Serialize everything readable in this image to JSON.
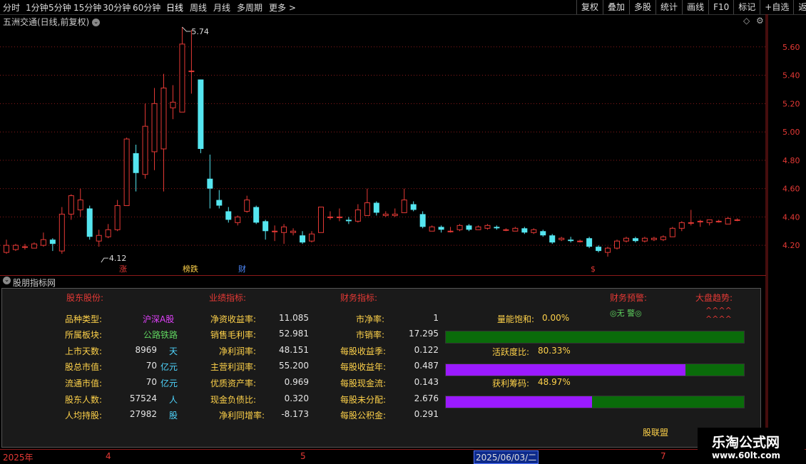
{
  "toolbar": {
    "periods": [
      "分时",
      "1分钟",
      "5分钟",
      "15分钟",
      "30分钟",
      "60分钟",
      "日线",
      "周线",
      "月线",
      "多周期",
      "更多 >"
    ],
    "active_period": "日线",
    "right_buttons": [
      "复权",
      "叠加",
      "多股",
      "统计",
      "画线",
      "F10",
      "标记",
      "+自选",
      "返回"
    ]
  },
  "chart": {
    "title": "五洲交通(日线,前复权)",
    "max_label": "5.74",
    "min_label": "4.12",
    "markers": [
      {
        "text": "涨",
        "color": "#e53935"
      },
      {
        "text": "榜跌",
        "color": "#ffd24a"
      },
      {
        "text": "财",
        "color": "#4f8bff"
      },
      {
        "text": "$",
        "color": "#e53935"
      }
    ]
  },
  "chart_data": {
    "type": "candlestick",
    "yticks": [
      4.2,
      4.4,
      4.6,
      4.8,
      5.0,
      5.2,
      5.4,
      5.6
    ],
    "ylim": [
      4.06,
      5.78
    ],
    "x_labels": [
      "2025年",
      "4",
      "5",
      "2025/06/03/二",
      "7"
    ],
    "candles": [
      {
        "o": 4.15,
        "c": 4.2,
        "h": 4.24,
        "l": 4.14
      },
      {
        "o": 4.17,
        "c": 4.2,
        "h": 4.21,
        "l": 4.16
      },
      {
        "o": 4.19,
        "c": 4.19,
        "h": 4.21,
        "l": 4.17
      },
      {
        "o": 4.18,
        "c": 4.21,
        "h": 4.22,
        "l": 4.18
      },
      {
        "o": 4.2,
        "c": 4.24,
        "h": 4.29,
        "l": 4.19
      },
      {
        "o": 4.24,
        "c": 4.21,
        "h": 4.25,
        "l": 4.16
      },
      {
        "o": 4.16,
        "c": 4.42,
        "h": 4.47,
        "l": 4.14
      },
      {
        "o": 4.42,
        "c": 4.55,
        "h": 4.56,
        "l": 4.38
      },
      {
        "o": 4.45,
        "c": 4.52,
        "h": 4.6,
        "l": 4.4
      },
      {
        "o": 4.46,
        "c": 4.26,
        "h": 4.48,
        "l": 4.24
      },
      {
        "o": 4.23,
        "c": 4.27,
        "h": 4.31,
        "l": 4.19
      },
      {
        "o": 4.26,
        "c": 4.31,
        "h": 4.35,
        "l": 4.25
      },
      {
        "o": 4.31,
        "c": 4.48,
        "h": 4.52,
        "l": 4.3
      },
      {
        "o": 4.48,
        "c": 4.95,
        "h": 4.96,
        "l": 4.48
      },
      {
        "o": 4.85,
        "c": 4.71,
        "h": 4.91,
        "l": 4.58
      },
      {
        "o": 4.7,
        "c": 5.04,
        "h": 5.2,
        "l": 4.67
      },
      {
        "o": 4.86,
        "c": 5.2,
        "h": 5.31,
        "l": 4.73
      },
      {
        "o": 4.88,
        "c": 5.31,
        "h": 5.41,
        "l": 4.58
      },
      {
        "o": 5.17,
        "c": 5.21,
        "h": 5.33,
        "l": 5.09
      },
      {
        "o": 5.14,
        "c": 5.62,
        "h": 5.74,
        "l": 5.14
      },
      {
        "o": 5.43,
        "c": 5.43,
        "h": 5.72,
        "l": 5.27
      },
      {
        "o": 5.37,
        "c": 4.88,
        "h": 5.37,
        "l": 4.85
      },
      {
        "o": 4.67,
        "c": 4.6,
        "h": 4.84,
        "l": 4.46
      },
      {
        "o": 4.52,
        "c": 4.48,
        "h": 4.59,
        "l": 4.46
      },
      {
        "o": 4.44,
        "c": 4.38,
        "h": 4.47,
        "l": 4.36
      },
      {
        "o": 4.36,
        "c": 4.4,
        "h": 4.41,
        "l": 4.34
      },
      {
        "o": 4.44,
        "c": 4.52,
        "h": 4.55,
        "l": 4.43
      },
      {
        "o": 4.47,
        "c": 4.36,
        "h": 4.48,
        "l": 4.35
      },
      {
        "o": 4.37,
        "c": 4.3,
        "h": 4.38,
        "l": 4.24
      },
      {
        "o": 4.3,
        "c": 4.3,
        "h": 4.34,
        "l": 4.23
      },
      {
        "o": 4.29,
        "c": 4.33,
        "h": 4.35,
        "l": 4.21
      },
      {
        "o": 4.29,
        "c": 4.3,
        "h": 4.32,
        "l": 4.27
      },
      {
        "o": 4.27,
        "c": 4.22,
        "h": 4.3,
        "l": 4.21
      },
      {
        "o": 4.23,
        "c": 4.28,
        "h": 4.3,
        "l": 4.22
      },
      {
        "o": 4.29,
        "c": 4.47,
        "h": 4.47,
        "l": 4.29
      },
      {
        "o": 4.4,
        "c": 4.4,
        "h": 4.44,
        "l": 4.38
      },
      {
        "o": 4.4,
        "c": 4.4,
        "h": 4.46,
        "l": 4.37
      },
      {
        "o": 4.38,
        "c": 4.37,
        "h": 4.4,
        "l": 4.35
      },
      {
        "o": 4.37,
        "c": 4.45,
        "h": 4.49,
        "l": 4.36
      },
      {
        "o": 4.41,
        "c": 4.5,
        "h": 4.6,
        "l": 4.41
      },
      {
        "o": 4.5,
        "c": 4.43,
        "h": 4.51,
        "l": 4.41
      },
      {
        "o": 4.41,
        "c": 4.42,
        "h": 4.44,
        "l": 4.4
      },
      {
        "o": 4.41,
        "c": 4.42,
        "h": 4.46,
        "l": 4.4
      },
      {
        "o": 4.43,
        "c": 4.52,
        "h": 4.6,
        "l": 4.43
      },
      {
        "o": 4.49,
        "c": 4.45,
        "h": 4.51,
        "l": 4.44
      },
      {
        "o": 4.42,
        "c": 4.33,
        "h": 4.44,
        "l": 4.32
      },
      {
        "o": 4.3,
        "c": 4.33,
        "h": 4.34,
        "l": 4.3
      },
      {
        "o": 4.33,
        "c": 4.31,
        "h": 4.34,
        "l": 4.29
      },
      {
        "o": 4.3,
        "c": 4.3,
        "h": 4.33,
        "l": 4.29
      },
      {
        "o": 4.31,
        "c": 4.34,
        "h": 4.35,
        "l": 4.3
      },
      {
        "o": 4.34,
        "c": 4.31,
        "h": 4.35,
        "l": 4.3
      },
      {
        "o": 4.31,
        "c": 4.33,
        "h": 4.34,
        "l": 4.31
      },
      {
        "o": 4.32,
        "c": 4.34,
        "h": 4.35,
        "l": 4.31
      },
      {
        "o": 4.33,
        "c": 4.32,
        "h": 4.34,
        "l": 4.31
      },
      {
        "o": 4.31,
        "c": 4.31,
        "h": 4.32,
        "l": 4.3
      },
      {
        "o": 4.3,
        "c": 4.32,
        "h": 4.33,
        "l": 4.3
      },
      {
        "o": 4.32,
        "c": 4.29,
        "h": 4.33,
        "l": 4.28
      },
      {
        "o": 4.29,
        "c": 4.31,
        "h": 4.32,
        "l": 4.28
      },
      {
        "o": 4.3,
        "c": 4.27,
        "h": 4.31,
        "l": 4.26
      },
      {
        "o": 4.27,
        "c": 4.22,
        "h": 4.28,
        "l": 4.21
      },
      {
        "o": 4.24,
        "c": 4.25,
        "h": 4.26,
        "l": 4.23
      },
      {
        "o": 4.24,
        "c": 4.23,
        "h": 4.26,
        "l": 4.22
      },
      {
        "o": 4.23,
        "c": 4.23,
        "h": 4.24,
        "l": 4.22
      },
      {
        "o": 4.25,
        "c": 4.19,
        "h": 4.26,
        "l": 4.18
      },
      {
        "o": 4.19,
        "c": 4.16,
        "h": 4.2,
        "l": 4.15
      },
      {
        "o": 4.15,
        "c": 4.18,
        "h": 4.19,
        "l": 4.12
      },
      {
        "o": 4.18,
        "c": 4.23,
        "h": 4.24,
        "l": 4.17
      },
      {
        "o": 4.23,
        "c": 4.25,
        "h": 4.26,
        "l": 4.22
      },
      {
        "o": 4.25,
        "c": 4.23,
        "h": 4.26,
        "l": 4.22
      },
      {
        "o": 4.23,
        "c": 4.25,
        "h": 4.26,
        "l": 4.22
      },
      {
        "o": 4.24,
        "c": 4.25,
        "h": 4.26,
        "l": 4.23
      },
      {
        "o": 4.24,
        "c": 4.26,
        "h": 4.27,
        "l": 4.23
      },
      {
        "o": 4.26,
        "c": 4.32,
        "h": 4.33,
        "l": 4.26
      },
      {
        "o": 4.32,
        "c": 4.36,
        "h": 4.37,
        "l": 4.3
      },
      {
        "o": 4.36,
        "c": 4.36,
        "h": 4.45,
        "l": 4.34
      },
      {
        "o": 4.37,
        "c": 4.37,
        "h": 4.38,
        "l": 4.33
      },
      {
        "o": 4.36,
        "c": 4.38,
        "h": 4.38,
        "l": 4.34
      },
      {
        "o": 4.37,
        "c": 4.37,
        "h": 4.38,
        "l": 4.36
      },
      {
        "o": 4.35,
        "c": 4.39,
        "h": 4.4,
        "l": 4.35
      },
      {
        "o": 4.38,
        "c": 4.38,
        "h": 4.39,
        "l": 4.37
      }
    ]
  },
  "indicator": {
    "header": "股朋指标网",
    "sections": [
      "股东股份:",
      "业绩指标:",
      "财务指标:",
      "财务预警:",
      "大盘趋势:"
    ],
    "col1": [
      {
        "label": "品种类型:",
        "value": "沪深A股",
        "unit": ""
      },
      {
        "label": "所属板块:",
        "value": "公路铁路",
        "unit": ""
      },
      {
        "label": "上市天数:",
        "value": "8969",
        "unit": "天"
      },
      {
        "label": "股总市值:",
        "value": "70",
        "unit": "亿元"
      },
      {
        "label": "流通市值:",
        "value": "70",
        "unit": "亿元"
      },
      {
        "label": "股东人数:",
        "value": "57524",
        "unit": "人"
      },
      {
        "label": "人均持股:",
        "value": "27982",
        "unit": "股"
      }
    ],
    "col2": [
      {
        "label": "净资收益率:",
        "value": "11.085"
      },
      {
        "label": "销售毛利率:",
        "value": "52.981"
      },
      {
        "label": "净利润率:",
        "value": "48.151"
      },
      {
        "label": "主营利润率:",
        "value": "55.200"
      },
      {
        "label": "优质资产率:",
        "value": "0.969"
      },
      {
        "label": "现金负债比:",
        "value": "0.320"
      },
      {
        "label": "净利同增率:",
        "value": "-8.173"
      }
    ],
    "col3": [
      {
        "label": "市净率:",
        "value": "1"
      },
      {
        "label": "市销率:",
        "value": "17.295"
      },
      {
        "label": "每股收益季:",
        "value": "0.122"
      },
      {
        "label": "每股收益年:",
        "value": "0.487"
      },
      {
        "label": "每股现金流:",
        "value": "0.143"
      },
      {
        "label": "每股未分配:",
        "value": "2.676"
      },
      {
        "label": "每股公积金:",
        "value": "0.291"
      }
    ],
    "warning": "◎无 警◎",
    "trend": [
      "^^^^",
      "^^^^"
    ],
    "gauges": [
      {
        "label": "量能饱和:",
        "value_text": "0.00%",
        "fraction": 0.0
      },
      {
        "label": "活跃度比:",
        "value_text": "80.33%",
        "fraction": 0.8033
      },
      {
        "label": "获利筹码:",
        "value_text": "48.97%",
        "fraction": 0.4897
      }
    ],
    "footer_text": "股联盟"
  },
  "watermark": {
    "name": "乐淘公式网",
    "url": "www.60lt.com"
  },
  "colors": {
    "up": "#e53935",
    "down": "#55e6f0",
    "grid": "#8b1a1a",
    "gauge_fill": "#9a1aff",
    "gauge_bg": "#0a6b0a"
  }
}
